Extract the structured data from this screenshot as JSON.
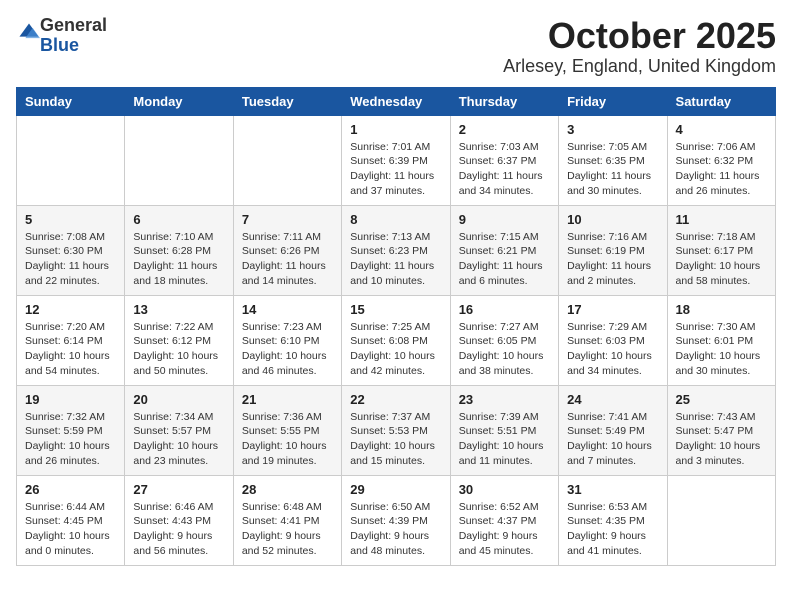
{
  "logo": {
    "general": "General",
    "blue": "Blue"
  },
  "header": {
    "month": "October 2025",
    "location": "Arlesey, England, United Kingdom"
  },
  "weekdays": [
    "Sunday",
    "Monday",
    "Tuesday",
    "Wednesday",
    "Thursday",
    "Friday",
    "Saturday"
  ],
  "weeks": [
    [
      {
        "day": "",
        "info": ""
      },
      {
        "day": "",
        "info": ""
      },
      {
        "day": "",
        "info": ""
      },
      {
        "day": "1",
        "info": "Sunrise: 7:01 AM\nSunset: 6:39 PM\nDaylight: 11 hours\nand 37 minutes."
      },
      {
        "day": "2",
        "info": "Sunrise: 7:03 AM\nSunset: 6:37 PM\nDaylight: 11 hours\nand 34 minutes."
      },
      {
        "day": "3",
        "info": "Sunrise: 7:05 AM\nSunset: 6:35 PM\nDaylight: 11 hours\nand 30 minutes."
      },
      {
        "day": "4",
        "info": "Sunrise: 7:06 AM\nSunset: 6:32 PM\nDaylight: 11 hours\nand 26 minutes."
      }
    ],
    [
      {
        "day": "5",
        "info": "Sunrise: 7:08 AM\nSunset: 6:30 PM\nDaylight: 11 hours\nand 22 minutes."
      },
      {
        "day": "6",
        "info": "Sunrise: 7:10 AM\nSunset: 6:28 PM\nDaylight: 11 hours\nand 18 minutes."
      },
      {
        "day": "7",
        "info": "Sunrise: 7:11 AM\nSunset: 6:26 PM\nDaylight: 11 hours\nand 14 minutes."
      },
      {
        "day": "8",
        "info": "Sunrise: 7:13 AM\nSunset: 6:23 PM\nDaylight: 11 hours\nand 10 minutes."
      },
      {
        "day": "9",
        "info": "Sunrise: 7:15 AM\nSunset: 6:21 PM\nDaylight: 11 hours\nand 6 minutes."
      },
      {
        "day": "10",
        "info": "Sunrise: 7:16 AM\nSunset: 6:19 PM\nDaylight: 11 hours\nand 2 minutes."
      },
      {
        "day": "11",
        "info": "Sunrise: 7:18 AM\nSunset: 6:17 PM\nDaylight: 10 hours\nand 58 minutes."
      }
    ],
    [
      {
        "day": "12",
        "info": "Sunrise: 7:20 AM\nSunset: 6:14 PM\nDaylight: 10 hours\nand 54 minutes."
      },
      {
        "day": "13",
        "info": "Sunrise: 7:22 AM\nSunset: 6:12 PM\nDaylight: 10 hours\nand 50 minutes."
      },
      {
        "day": "14",
        "info": "Sunrise: 7:23 AM\nSunset: 6:10 PM\nDaylight: 10 hours\nand 46 minutes."
      },
      {
        "day": "15",
        "info": "Sunrise: 7:25 AM\nSunset: 6:08 PM\nDaylight: 10 hours\nand 42 minutes."
      },
      {
        "day": "16",
        "info": "Sunrise: 7:27 AM\nSunset: 6:05 PM\nDaylight: 10 hours\nand 38 minutes."
      },
      {
        "day": "17",
        "info": "Sunrise: 7:29 AM\nSunset: 6:03 PM\nDaylight: 10 hours\nand 34 minutes."
      },
      {
        "day": "18",
        "info": "Sunrise: 7:30 AM\nSunset: 6:01 PM\nDaylight: 10 hours\nand 30 minutes."
      }
    ],
    [
      {
        "day": "19",
        "info": "Sunrise: 7:32 AM\nSunset: 5:59 PM\nDaylight: 10 hours\nand 26 minutes."
      },
      {
        "day": "20",
        "info": "Sunrise: 7:34 AM\nSunset: 5:57 PM\nDaylight: 10 hours\nand 23 minutes."
      },
      {
        "day": "21",
        "info": "Sunrise: 7:36 AM\nSunset: 5:55 PM\nDaylight: 10 hours\nand 19 minutes."
      },
      {
        "day": "22",
        "info": "Sunrise: 7:37 AM\nSunset: 5:53 PM\nDaylight: 10 hours\nand 15 minutes."
      },
      {
        "day": "23",
        "info": "Sunrise: 7:39 AM\nSunset: 5:51 PM\nDaylight: 10 hours\nand 11 minutes."
      },
      {
        "day": "24",
        "info": "Sunrise: 7:41 AM\nSunset: 5:49 PM\nDaylight: 10 hours\nand 7 minutes."
      },
      {
        "day": "25",
        "info": "Sunrise: 7:43 AM\nSunset: 5:47 PM\nDaylight: 10 hours\nand 3 minutes."
      }
    ],
    [
      {
        "day": "26",
        "info": "Sunrise: 6:44 AM\nSunset: 4:45 PM\nDaylight: 10 hours\nand 0 minutes."
      },
      {
        "day": "27",
        "info": "Sunrise: 6:46 AM\nSunset: 4:43 PM\nDaylight: 9 hours\nand 56 minutes."
      },
      {
        "day": "28",
        "info": "Sunrise: 6:48 AM\nSunset: 4:41 PM\nDaylight: 9 hours\nand 52 minutes."
      },
      {
        "day": "29",
        "info": "Sunrise: 6:50 AM\nSunset: 4:39 PM\nDaylight: 9 hours\nand 48 minutes."
      },
      {
        "day": "30",
        "info": "Sunrise: 6:52 AM\nSunset: 4:37 PM\nDaylight: 9 hours\nand 45 minutes."
      },
      {
        "day": "31",
        "info": "Sunrise: 6:53 AM\nSunset: 4:35 PM\nDaylight: 9 hours\nand 41 minutes."
      },
      {
        "day": "",
        "info": ""
      }
    ]
  ]
}
